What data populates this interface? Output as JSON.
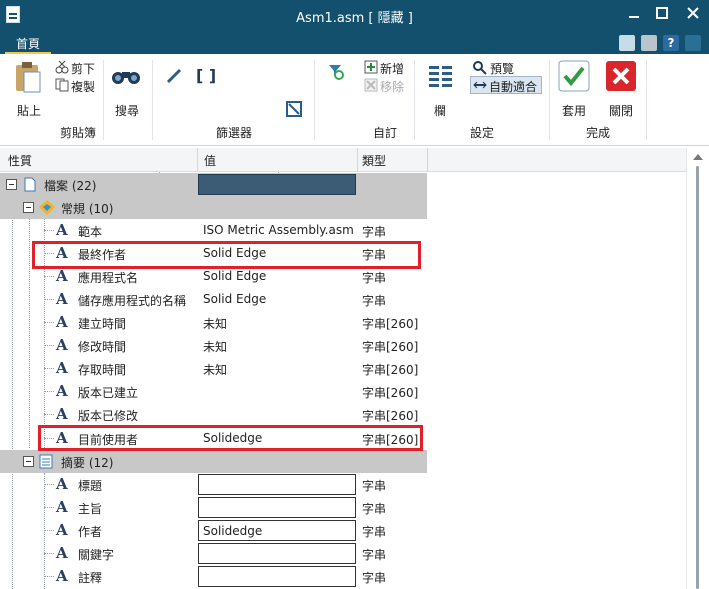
{
  "window": {
    "title": "Asm1.asm [ 隱藏 ]",
    "minimize_icon": "minimize-icon",
    "maximize_icon": "maximize-icon",
    "close_icon": "close-icon"
  },
  "tabs": {
    "home": "首頁"
  },
  "ribbon": {
    "paste_label": "貼上",
    "cut_label": "剪下",
    "copy_label": "複製",
    "clipboard_group": "剪貼簿",
    "search_label": "搜尋",
    "filter_group": "篩選器",
    "filter_value": "",
    "new_label": "新增",
    "remove_label": "移除",
    "custom_group": "自訂",
    "columns_label": "欄",
    "preview_label": "預覽",
    "autofit_label": "自動適合",
    "settings_group": "設定",
    "apply_label": "套用",
    "close_label": "關閉",
    "finish_group": "完成"
  },
  "grid": {
    "headers": {
      "property": "性質",
      "value": "值",
      "type": "類型"
    },
    "groups": {
      "file": "檔案 (22)",
      "general": "常規 (10)",
      "summary": "摘要 (12)"
    },
    "general_rows": [
      {
        "name": "範本",
        "value": "ISO Metric Assembly.asm",
        "type": "字串"
      },
      {
        "name": "最終作者",
        "value": "Solid Edge",
        "type": "字串"
      },
      {
        "name": "應用程式名",
        "value": "Solid Edge",
        "type": "字串"
      },
      {
        "name": "儲存應用程式的名稱",
        "value": "Solid Edge",
        "type": "字串"
      },
      {
        "name": "建立時間",
        "value": "未知",
        "type": "字串[260]"
      },
      {
        "name": "修改時間",
        "value": "未知",
        "type": "字串[260]"
      },
      {
        "name": "存取時間",
        "value": "未知",
        "type": "字串[260]"
      },
      {
        "name": "版本已建立",
        "value": "",
        "type": "字串[260]"
      },
      {
        "name": "版本已修改",
        "value": "",
        "type": "字串[260]"
      },
      {
        "name": "目前使用者",
        "value": "Solidedge",
        "type": "字串[260]"
      }
    ],
    "summary_rows": [
      {
        "name": "標題",
        "value": "",
        "type": "字串"
      },
      {
        "name": "主旨",
        "value": "",
        "type": "字串"
      },
      {
        "name": "作者",
        "value": "Solidedge",
        "type": "字串"
      },
      {
        "name": "關鍵字",
        "value": "",
        "type": "字串"
      },
      {
        "name": "註釋",
        "value": "",
        "type": "字串"
      }
    ]
  },
  "colors": {
    "titlebar": "#13506e",
    "group_row": "#c8c8c8",
    "highlight": "#e0202a",
    "selected_value": "#3c5b74"
  }
}
